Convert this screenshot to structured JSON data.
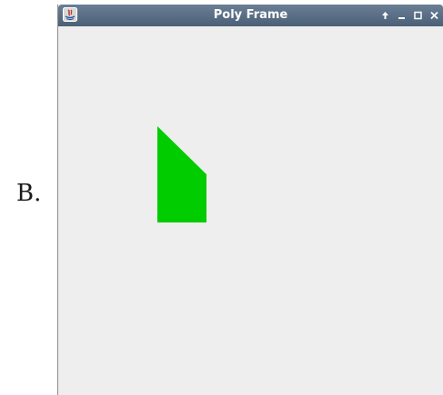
{
  "option": {
    "label": "B."
  },
  "window": {
    "title": "Poly Frame",
    "controls": [
      "pin-icon",
      "minimize-icon",
      "maximize-icon",
      "close-icon"
    ]
  },
  "canvas": {
    "background": "#eeeeee",
    "polygon": {
      "fill": "#00cc00"
    }
  },
  "colors": {
    "titlebar": "#576c83",
    "title_text": "#ffffff"
  }
}
